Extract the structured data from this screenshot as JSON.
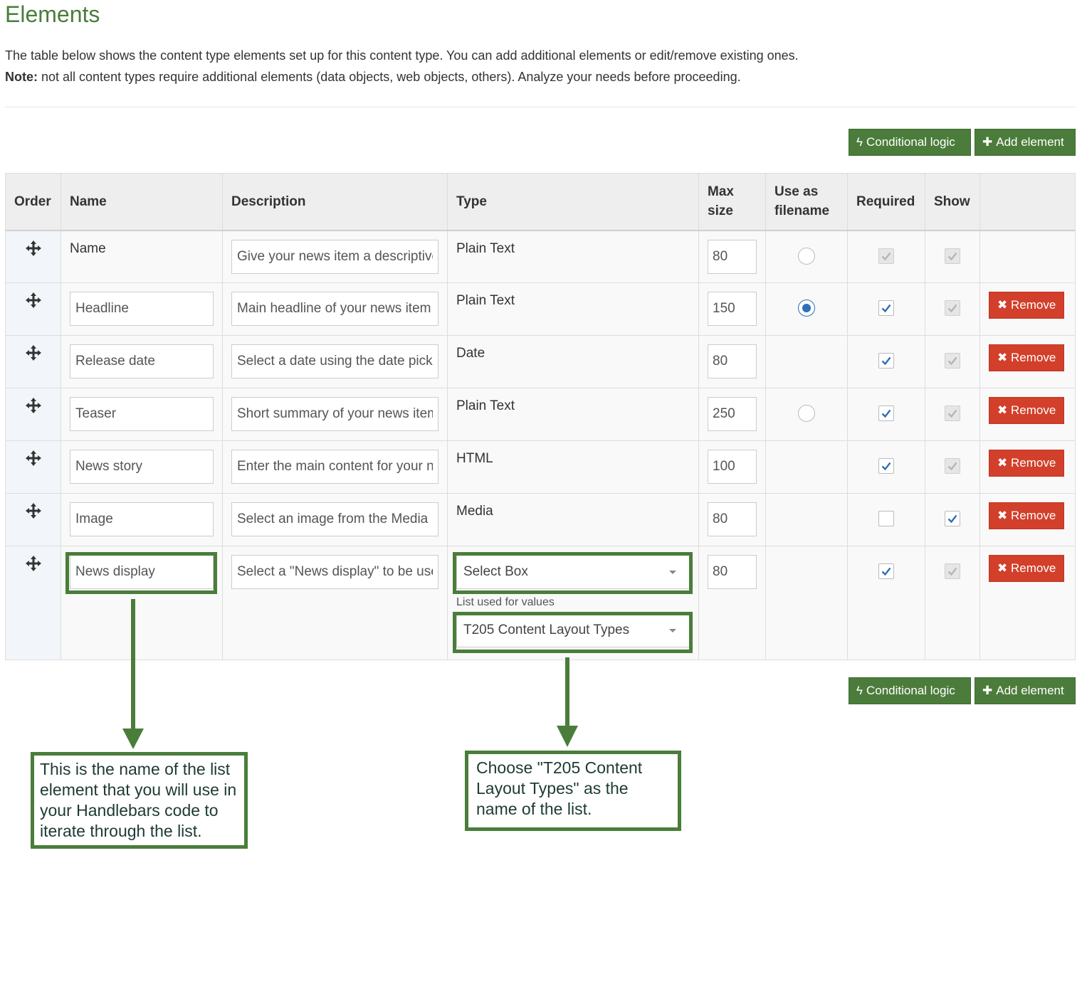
{
  "page": {
    "title": "Elements",
    "intro": "The table below shows the content type elements set up for this content type. You can add additional elements or edit/remove existing ones.",
    "note_label": "Note:",
    "note_text": " not all content types require additional elements (data objects, web objects, others). Analyze your needs before proceeding."
  },
  "toolbar": {
    "conditional_logic_label": "Conditional logic",
    "add_element_label": "Add element"
  },
  "table": {
    "headers": {
      "order": "Order",
      "name": "Name",
      "description": "Description",
      "type": "Type",
      "max_size_1": "Max",
      "max_size_2": "size",
      "use_as_filename_1": "Use as",
      "use_as_filename_2": "filename",
      "required": "Required",
      "show": "Show"
    },
    "remove_label": "Remove",
    "rows": [
      {
        "name": "Name",
        "description": "Give your news item a descriptive name",
        "type": "Plain Text",
        "max_size": "80"
      },
      {
        "name": "Headline",
        "description": "Main headline of your news item",
        "type": "Plain Text",
        "max_size": "150"
      },
      {
        "name": "Release date",
        "description": "Select a date using the date picker",
        "type": "Date",
        "max_size": "80"
      },
      {
        "name": "Teaser",
        "description": "Short summary of your news item",
        "type": "Plain Text",
        "max_size": "250"
      },
      {
        "name": "News story",
        "description": "Enter the main content for your news item",
        "type": "HTML",
        "max_size": "100"
      },
      {
        "name": "Image",
        "description": "Select an image from the Media Library",
        "type": "Media",
        "max_size": "80"
      },
      {
        "name": "News display",
        "description": "Select a \"News display\" to be used",
        "type": "Select Box",
        "max_size": "80",
        "list_label": "List used for values",
        "list_value": "T205 Content Layout Types"
      }
    ]
  },
  "annotations": {
    "name_note": "This is the name of the list element that you will use in your Handlebars code to iterate through the list.",
    "list_note": "Choose \"T205 Content Layout Types\" as the name of the list."
  },
  "colors": {
    "accent_green": "#4b7c3b",
    "remove_red": "#d23f2b",
    "check_blue": "#2d6fb8"
  }
}
